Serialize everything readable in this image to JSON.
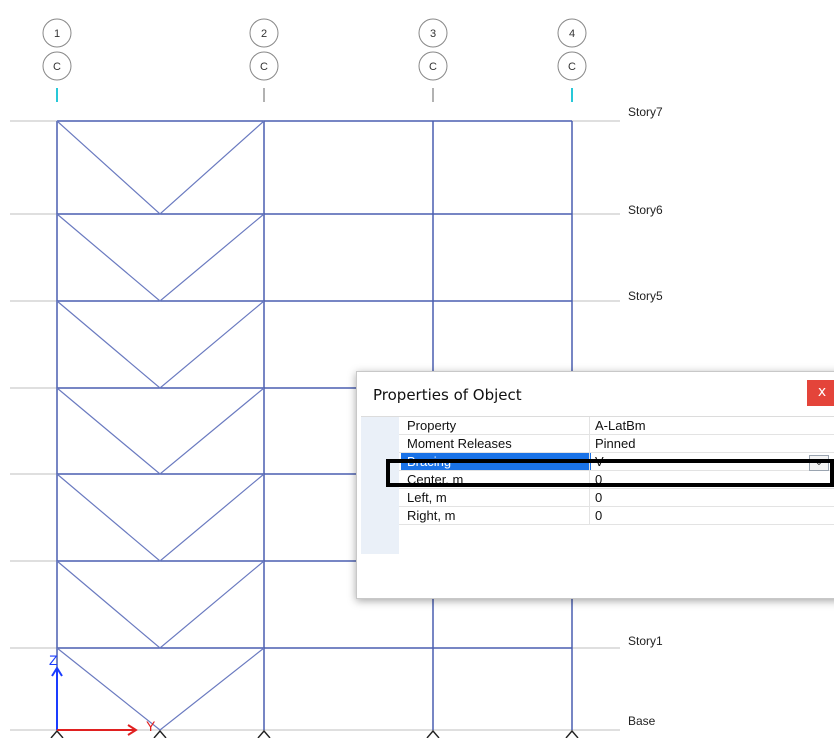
{
  "gridlines": [
    {
      "label": "1",
      "sub": "C"
    },
    {
      "label": "2",
      "sub": "C"
    },
    {
      "label": "3",
      "sub": "C"
    },
    {
      "label": "4",
      "sub": "C"
    }
  ],
  "stories": [
    "Story7",
    "Story6",
    "Story5",
    "Story1",
    "Base"
  ],
  "axes": {
    "z": "Z",
    "y": "Y"
  },
  "dialog": {
    "title": "Properties of Object",
    "close": "x",
    "rows": [
      {
        "name": "Property",
        "value": "A-LatBm"
      },
      {
        "name": "Moment Releases",
        "value": "Pinned"
      },
      {
        "name": "Bracing",
        "value": "V"
      },
      {
        "name": "Center, m",
        "value": "0"
      },
      {
        "name": "Left, m",
        "value": "0"
      },
      {
        "name": "Right, m",
        "value": "0"
      }
    ],
    "dropdown_icon": "chevron-down-icon"
  },
  "colors": {
    "frame": "#4a5fb0",
    "story_line": "#bfbfbf",
    "accent": "#1a73e8",
    "close": "#e4443a",
    "axis_z": "#1a3cff",
    "axis_y": "#e02020",
    "column_tip": "#28c8d8"
  }
}
